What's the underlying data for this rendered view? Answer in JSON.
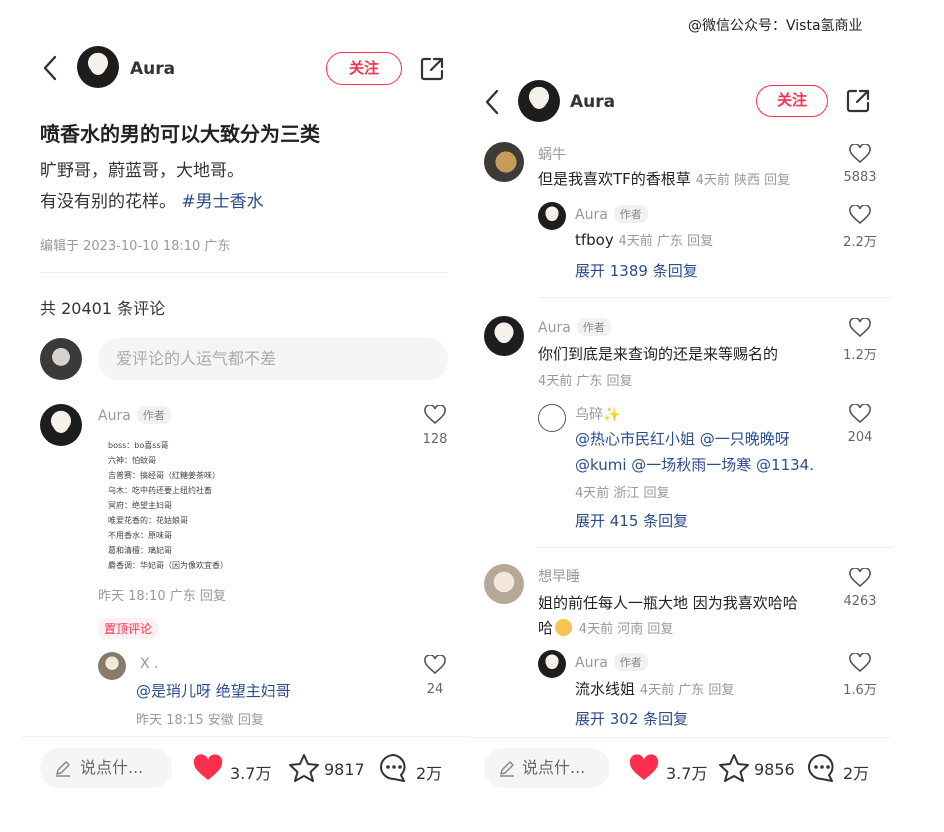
{
  "watermark": "@微信公众号：Vista氢商业",
  "left": {
    "author": "Aura",
    "follow_label": "关注",
    "title": "喷香水的男的可以大致分为三类",
    "body_line1": "旷野哥，蔚蓝哥，大地哥。",
    "body_line2": "有没有别的花样。",
    "tag": "#男士香水",
    "edited": "编辑于 2023-10-10 18:10 广东",
    "comment_count": "共 20401 条评论",
    "input_placeholder": "爱评论的人运气都不差",
    "comment1": {
      "name": "Aura",
      "badge": "作者",
      "likes": "128",
      "image_lines": [
        "boss：bo喜ss哥",
        "六神：怕蚊哥",
        "吉普赛：搞经哥（红糖姜茶味）",
        "乌木：吃中药还要上纽约社畜",
        "冥府：绝望主妇哥",
        "唯爱花香的：花姑娘哥",
        "不用香水：原味哥",
        "葛和清檀：璃妃哥",
        "麝香调：华妃哥（因为像欢宜香）"
      ],
      "meta": "昨天 18:10 广东 回复",
      "pin": "置顶评论"
    },
    "reply1": {
      "name": "X .",
      "text": "@是琑儿呀 绝望主妇哥",
      "likes": "24",
      "meta": "昨天 18:15 安徽 回复"
    },
    "bottom": {
      "say": "说点什...",
      "likes": "3.7万",
      "stars": "9817",
      "comments": "2万"
    }
  },
  "right": {
    "author": "Aura",
    "follow_label": "关注",
    "c1": {
      "name": "蜗牛",
      "text": "但是我喜欢TF的香根草",
      "meta": "4天前 陕西 回复",
      "likes": "5883",
      "reply": {
        "name": "Aura",
        "badge": "作者",
        "text": "tfboy",
        "meta": "4天前 广东 回复",
        "likes": "2.2万"
      },
      "expand": "展开 1389 条回复"
    },
    "c2": {
      "name": "Aura",
      "badge": "作者",
      "text": "你们到底是来查询的还是来等赐名的",
      "meta": "4天前 广东 回复",
      "likes": "1.2万",
      "reply": {
        "name": "乌碎✨",
        "line1": "@热心市民红小姐 @一只晚晚呀",
        "line2": "@kumi @一场秋雨一场寒 @1134.",
        "meta": "4天前 浙江 回复",
        "likes": "204"
      },
      "expand": "展开 415 条回复"
    },
    "c3": {
      "name": "想早睡",
      "line1": "姐的前任每人一瓶大地 因为我喜欢哈哈",
      "line2": "哈",
      "meta": "4天前 河南 回复",
      "likes": "4263",
      "reply": {
        "name": "Aura",
        "badge": "作者",
        "text": "流水线姐",
        "meta": "4天前 广东 回复",
        "likes": "1.6万"
      },
      "expand": "展开 302 条回复"
    },
    "bottom": {
      "say": "说点什...",
      "likes": "3.7万",
      "stars": "9856",
      "comments": "2万"
    }
  },
  "colors": {
    "accent": "#ff2e4d",
    "link": "#2a4e8c",
    "meta": "#999999"
  }
}
